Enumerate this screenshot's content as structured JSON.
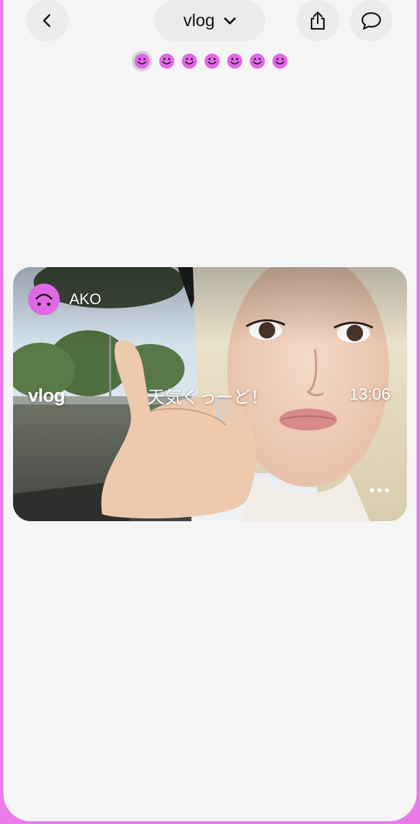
{
  "header": {
    "title": "vlog",
    "back_icon": "chevron-left-icon",
    "dropdown_icon": "chevron-down-icon",
    "share_icon": "share-icon",
    "comment_icon": "speech-bubble-icon"
  },
  "indicators": {
    "count": 7,
    "active_index": 0,
    "icon": "smiley-icon",
    "color": "#e068e6"
  },
  "post": {
    "username": "AKO",
    "avatar_icon": "upside-down-smiley-icon",
    "tag": "vlog",
    "caption": "天気ぐっーど！",
    "time": "13:06",
    "more_icon": "more-horizontal-icon"
  },
  "colors": {
    "accent": "#e97cea",
    "background": "#f5f5f5",
    "button_bg": "#ebebeb"
  }
}
